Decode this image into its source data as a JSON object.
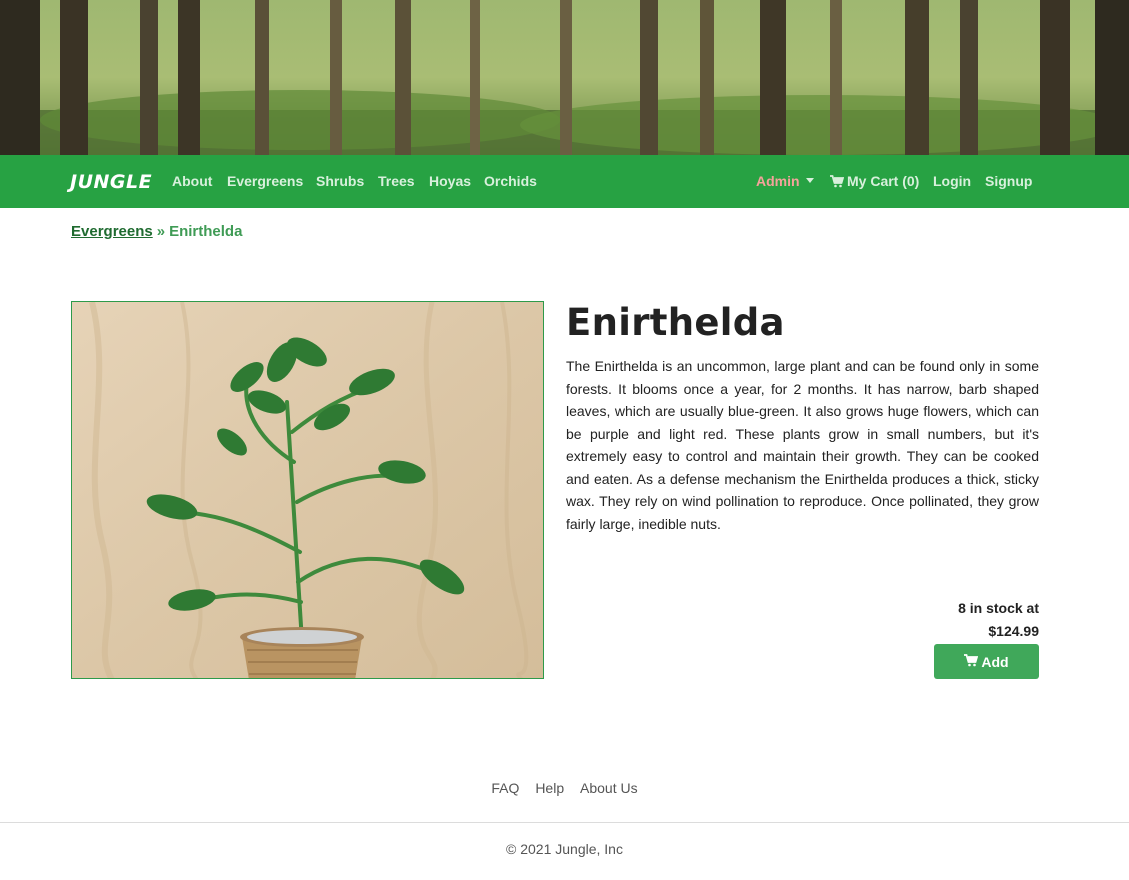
{
  "colors": {
    "navbar_green": "#27a243",
    "add_button_green": "#40a85a",
    "admin_salmon": "#f4a39b",
    "breadcrumb_dark_green": "#1f6b30",
    "breadcrumb_light_green": "#3f9b55"
  },
  "navbar": {
    "brand": "JUNGLE",
    "links": [
      "About",
      "Evergreens",
      "Shrubs",
      "Trees",
      "Hoyas",
      "Orchids"
    ],
    "admin_label": "Admin",
    "cart_icon": "shopping-cart-icon",
    "cart_label": "My Cart (0)",
    "login_label": "Login",
    "signup_label": "Signup"
  },
  "breadcrumb": {
    "parent": "Evergreens",
    "separator": "»",
    "current": "Enirthelda"
  },
  "product": {
    "name": "Enirthelda",
    "description": "The Enirthelda is an uncommon, large plant and can be found only in some forests. It blooms once a year, for 2 months. It has narrow, barb shaped leaves, which are usually blue-green. It also grows huge flowers, which can be purple and light red. These plants grow in small numbers, but it's extremely easy to control and maintain their growth. They can be cooked and eaten. As a defense mechanism the Enirthelda produces a thick, sticky wax. They rely on wind pollination to reproduce. Once pollinated, they grow fairly large, inedible nuts.",
    "stock_text": "8 in stock at",
    "price": "$124.99",
    "add_label": "Add"
  },
  "footer": {
    "links": [
      "FAQ",
      "Help",
      "About Us"
    ],
    "copyright": "© 2021 Jungle, Inc"
  }
}
